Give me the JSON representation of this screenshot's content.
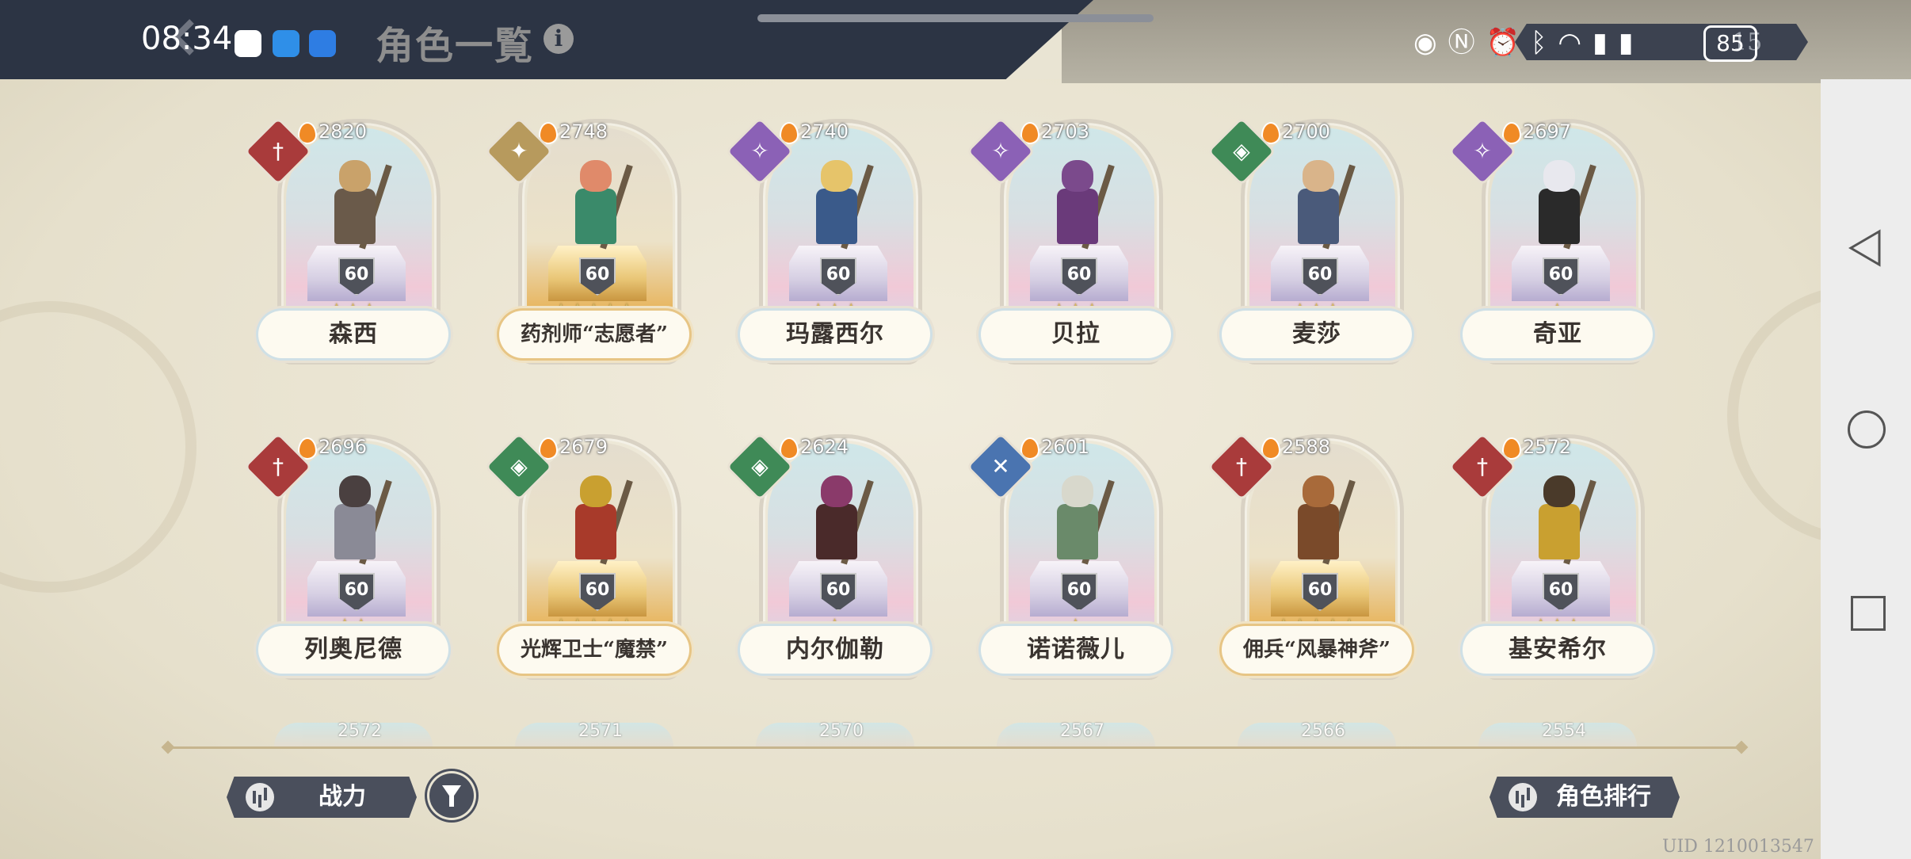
{
  "status_bar": {
    "time": "08:34",
    "battery": "85",
    "sys_text": "15"
  },
  "header": {
    "title": "角色一覧",
    "info_symbol": "i"
  },
  "characters_row1": [
    {
      "name": "森西",
      "power": "2820",
      "level": "60",
      "stars": "★★★",
      "class_color": "#a93b3b",
      "class_icon": "sword-icon"
    },
    {
      "name": "药剂师“志愿者”",
      "power": "2748",
      "level": "60",
      "stars": "★★★★★",
      "class_color": "#b79a5d",
      "class_icon": "sparkle-icon"
    },
    {
      "name": "玛露西尔",
      "power": "2740",
      "level": "60",
      "stars": "★★★",
      "class_color": "#8b61b6",
      "class_icon": "magic-icon"
    },
    {
      "name": "贝拉",
      "power": "2703",
      "level": "60",
      "stars": "★★★",
      "class_color": "#8b61b6",
      "class_icon": "magic-icon"
    },
    {
      "name": "麦莎",
      "power": "2700",
      "level": "60",
      "stars": "★★★",
      "class_color": "#3f8a57",
      "class_icon": "shield-icon"
    },
    {
      "name": "奇亚",
      "power": "2697",
      "level": "60",
      "stars": "★",
      "class_color": "#8b61b6",
      "class_icon": "magic-icon"
    }
  ],
  "characters_row2": [
    {
      "name": "列奥尼德",
      "power": "2696",
      "level": "60",
      "stars": "★★",
      "class_color": "#a93b3b",
      "class_icon": "sword-icon"
    },
    {
      "name": "光辉卫士“魔禁”",
      "power": "2679",
      "level": "60",
      "stars": "★★★★★",
      "class_color": "#3f8a57",
      "class_icon": "shield-icon"
    },
    {
      "name": "内尔伽勒",
      "power": "2624",
      "level": "60",
      "stars": "★",
      "class_color": "#3f8a57",
      "class_icon": "shield-icon"
    },
    {
      "name": "诺诺薇儿",
      "power": "2601",
      "level": "60",
      "stars": "★",
      "class_color": "#4a74b0",
      "class_icon": "crossed-icon"
    },
    {
      "name": "佣兵“风暴神斧”",
      "power": "2588",
      "level": "60",
      "stars": "★★★★★",
      "class_color": "#a93b3b",
      "class_icon": "sword-icon"
    },
    {
      "name": "基安希尔",
      "power": "2572",
      "level": "60",
      "stars": "★★★",
      "class_color": "#a93b3b",
      "class_icon": "sword-icon"
    }
  ],
  "row3_powers": [
    "2572",
    "2571",
    "2570",
    "2567",
    "2566",
    "2554"
  ],
  "buttons": {
    "sort_label": "战力",
    "ranking_label": "角色排行"
  },
  "uid": "UID 1210013547"
}
